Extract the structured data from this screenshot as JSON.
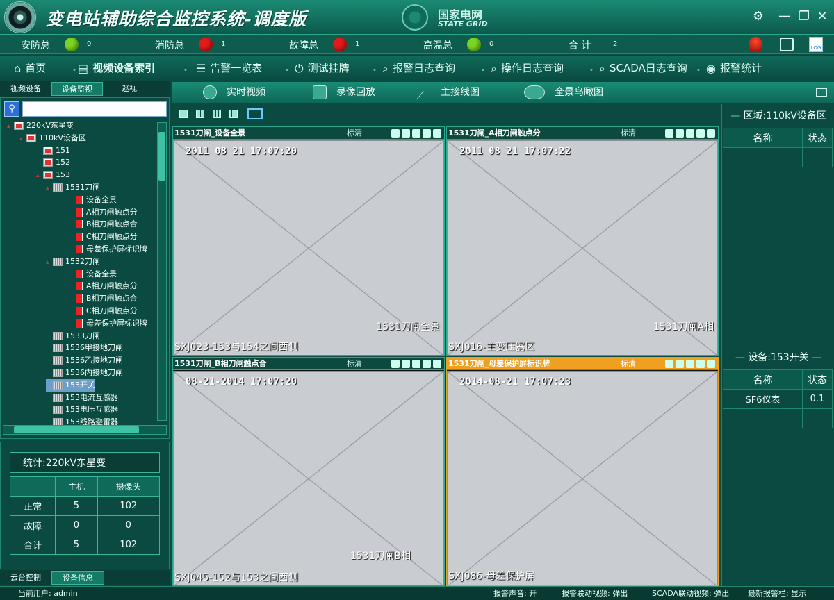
{
  "app": {
    "title": "变电站辅助综合监控系统-调度版",
    "brand_cn": "国家电网",
    "brand_en": "STATE GRID"
  },
  "status": [
    {
      "label": "安防总",
      "color": "#7bd322",
      "value": "0"
    },
    {
      "label": "消防总",
      "color": "#e01b1b",
      "value": "1"
    },
    {
      "label": "故障总",
      "color": "#e01b1b",
      "value": "1"
    },
    {
      "label": "高温总",
      "color": "#7bd322",
      "value": "0"
    },
    {
      "label": "合 计",
      "value": "2"
    }
  ],
  "menu": [
    {
      "label": "首页",
      "icon": "home-icon"
    },
    {
      "label": "视频设备索引",
      "icon": "video-device-icon"
    },
    {
      "label": "告警一览表",
      "icon": "list-icon"
    },
    {
      "label": "测试挂牌",
      "icon": "power-icon"
    },
    {
      "label": "报警日志查询",
      "icon": "search-log-icon"
    },
    {
      "label": "操作日志查询",
      "icon": "search-log-icon"
    },
    {
      "label": "SCADA日志查询",
      "icon": "search-log-icon"
    },
    {
      "label": "报警统计",
      "icon": "record-icon"
    }
  ],
  "left_tabs": [
    "视频设备",
    "设备监视",
    "巡视"
  ],
  "search": {
    "placeholder": ""
  },
  "tree": [
    {
      "label": "220kV东星变",
      "level": 0,
      "icon": "substation"
    },
    {
      "label": "110kV设备区",
      "level": 1,
      "icon": "substation"
    },
    {
      "label": "151",
      "level": 2,
      "icon": "substation"
    },
    {
      "label": "152",
      "level": 2,
      "icon": "substation"
    },
    {
      "label": "153",
      "level": 2,
      "icon": "substation"
    },
    {
      "label": "1531刀闸",
      "level": 3,
      "icon": "grid"
    },
    {
      "label": "设备全景",
      "level": 4,
      "icon": "flag"
    },
    {
      "label": "A相刀闸触点分",
      "level": 4,
      "icon": "flag"
    },
    {
      "label": "B相刀闸触点合",
      "level": 4,
      "icon": "flag"
    },
    {
      "label": "C相刀闸触点分",
      "level": 4,
      "icon": "flag"
    },
    {
      "label": "母差保护屏标识牌",
      "level": 4,
      "icon": "flag"
    },
    {
      "label": "1532刀闸",
      "level": 3,
      "icon": "grid"
    },
    {
      "label": "设备全景",
      "level": 4,
      "icon": "flag"
    },
    {
      "label": "A相刀闸触点分",
      "level": 4,
      "icon": "flag"
    },
    {
      "label": "B相刀闸触点合",
      "level": 4,
      "icon": "flag"
    },
    {
      "label": "C相刀闸触点分",
      "level": 4,
      "icon": "flag"
    },
    {
      "label": "母差保护屏标识牌",
      "level": 4,
      "icon": "flag"
    },
    {
      "label": "1533刀闸",
      "level": 3,
      "icon": "grid"
    },
    {
      "label": "1536甲接地刀闸",
      "level": 3,
      "icon": "grid"
    },
    {
      "label": "1536乙接地刀闸",
      "level": 3,
      "icon": "grid"
    },
    {
      "label": "1536内接地刀闸",
      "level": 3,
      "icon": "grid"
    },
    {
      "label": "153开关",
      "level": 3,
      "icon": "grid",
      "selected": true
    },
    {
      "label": "153电流互感器",
      "level": 3,
      "icon": "grid"
    },
    {
      "label": "153电压互感器",
      "level": 3,
      "icon": "grid"
    },
    {
      "label": "153线路避雷器",
      "level": 3,
      "icon": "grid"
    }
  ],
  "stats": {
    "title": "统计:220kV东星变",
    "headers": [
      "",
      "主机",
      "摄像头"
    ],
    "rows": [
      [
        "正常",
        "5",
        "102"
      ],
      [
        "故障",
        "0",
        "0"
      ],
      [
        "合计",
        "5",
        "102"
      ]
    ]
  },
  "left_bottom_tabs": [
    "云台控制",
    "设备信息"
  ],
  "video_tabs": [
    "实时视频",
    "录像回放",
    "主接线图",
    "全景鸟瞰图"
  ],
  "panes": [
    {
      "title": "1531刀闸_设备全景",
      "quality": "标清",
      "time": "2011 08 21 17:07:20",
      "label": "1531刀闸全景",
      "cam": "SXJ023-153与154之间西侧",
      "highlight": false
    },
    {
      "title": "1531刀闸_A相刀闸触点分",
      "quality": "标清",
      "time": "2011 08 21 17:07:22",
      "label": "1531刀闸A相",
      "cam": "SXJ016-主变压器区",
      "highlight": false
    },
    {
      "title": "1531刀闸_B相刀闸触点合",
      "quality": "标清",
      "time": "08-21-2014 17:07:20",
      "label": "1531刀闸B相",
      "cam": "SXJ045-152与153之间西侧",
      "highlight": false
    },
    {
      "title": "1531刀闸_母差保护屏标识牌",
      "quality": "标清",
      "time": "2014-08-21 17:07:23",
      "label": "",
      "cam": "SXJ086-母差保护屏",
      "highlight": true
    }
  ],
  "right": {
    "area_title": "区域:110kV设备区",
    "area_headers": [
      "名称",
      "状态"
    ],
    "device_title": "设备:153开关",
    "device_headers": [
      "名称",
      "状态"
    ],
    "device_rows": [
      [
        "SF6仪表",
        "0.1"
      ]
    ]
  },
  "footer": {
    "user": "当前用户: admin",
    "sound": "报警声音: 开",
    "linkage": "报警联动视频: 弹出",
    "scada": "SCADA联动视频: 弹出",
    "latest": "最新报警栏: 显示"
  }
}
